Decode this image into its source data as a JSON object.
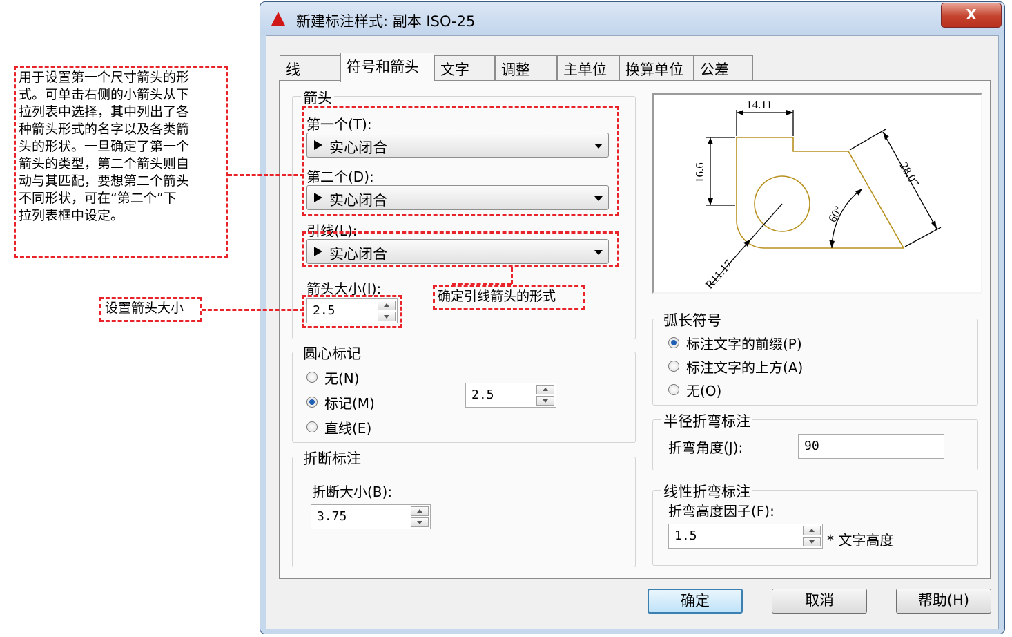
{
  "dialog": {
    "title": "新建标注样式: 副本 ISO-25",
    "close_label": "X",
    "title_icon": "autocad-logo-icon"
  },
  "tabs": [
    {
      "label": "线",
      "active": false
    },
    {
      "label": "符号和箭头",
      "active": true
    },
    {
      "label": "文字",
      "active": false
    },
    {
      "label": "调整",
      "active": false
    },
    {
      "label": "主单位",
      "active": false
    },
    {
      "label": "换算单位",
      "active": false
    },
    {
      "label": "公差",
      "active": false
    }
  ],
  "arrowheads": {
    "group_label": "箭头",
    "first_label": "第一个(T):",
    "first_value": "实心闭合",
    "second_label": "第二个(D):",
    "second_value": "实心闭合",
    "leader_label": "引线(L):",
    "leader_value": "实心闭合",
    "size_label": "箭头大小(I):",
    "size_value": "2.5"
  },
  "center_marks": {
    "group_label": "圆心标记",
    "options": [
      "无(N)",
      "标记(M)",
      "直线(E)"
    ],
    "selected": "标记(M)",
    "size_value": "2.5"
  },
  "dim_break": {
    "group_label": "折断标注",
    "size_label": "折断大小(B):",
    "size_value": "3.75"
  },
  "preview": {
    "dims": {
      "top": "14.11",
      "left": "16.6",
      "angle": "60°",
      "right": "28.07",
      "radius": "R11.17"
    },
    "line_color": "#b8901e"
  },
  "arc_length": {
    "group_label": "弧长符号",
    "options": [
      "标注文字的前缀(P)",
      "标注文字的上方(A)",
      "无(O)"
    ],
    "selected": "标注文字的前缀(P)"
  },
  "radius_jog": {
    "group_label": "半径折弯标注",
    "angle_label": "折弯角度(J):",
    "angle_value": "90"
  },
  "linear_jog": {
    "group_label": "线性折弯标注",
    "factor_label": "折弯高度因子(F):",
    "factor_value": "1.5",
    "suffix": "* 文字高度"
  },
  "buttons": {
    "ok": "确定",
    "cancel": "取消",
    "help": "帮助(H)"
  },
  "annotations": {
    "arrow_desc": [
      "用于设置第一个尺寸箭头的形",
      "式。可单击右侧的小箭头从下",
      "拉列表中选择，其中列出了各",
      "种箭头形式的名字以及各类箭",
      "头的形状。一旦确定了第一个",
      "箭头的类型，第二个箭头则自",
      "动与其匹配，要想第二个箭头",
      "不同形状，可在“第二个”下",
      "拉列表框中设定。"
    ],
    "size_desc": "设置箭头大小",
    "leader_desc": "确定引线箭头的形式"
  },
  "colors": {
    "annotation_red": "#e8242a",
    "accent": "#3c7fb1"
  }
}
